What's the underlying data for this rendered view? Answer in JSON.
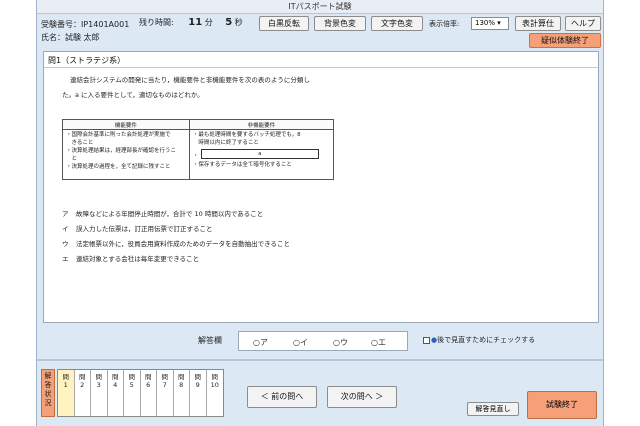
{
  "window": {
    "title": "ITパスポート試験"
  },
  "header": {
    "exam_number_label": "受験番号：IP1401A001",
    "name_label": "氏名：試験 太郎",
    "remaining_label": "残り時間:",
    "minutes": "11",
    "minutes_unit": "分",
    "seconds": "5",
    "seconds_unit": "秒"
  },
  "toolbar": {
    "invert_label": "白黒反転",
    "bg_color_label": "背景色変",
    "text_color_label": "文字色変",
    "zoom_label": "表示倍率:",
    "zoom_value": "130% ▾",
    "calc_label": "表計算仕",
    "help_label": "ヘルプ",
    "end_mock_label": "疑似体験終了"
  },
  "question": {
    "title": "問1（ストラテジ系）",
    "stem_line1": "連結会計システムの開発に当たり，機能要件と非機能要件を次の表のように分類し",
    "stem_line2": "た。a に入る要件として，適切なものはどれか。",
    "table": {
      "headers": [
        "機能要件",
        "非機能要件"
      ],
      "functional": [
        "・国際会計基準に則った会計処理が実施で",
        "　きること",
        "・決算処理結果は，経理部長が確認を行うこ",
        "　と",
        "・決算処理の過程を，全て記録に残すこと"
      ],
      "nonfunctional_top": [
        "・最も処理時間を要するバッチ処理でも，8",
        "　時間以内に終了すること"
      ],
      "blank_bullet": "・",
      "blank_label": "a",
      "nonfunctional_bottom": "・保存するデータは全て暗号化すること"
    },
    "choices": [
      {
        "key": "ア",
        "text": "故障などによる年間停止時間が，合計で 10 時間以内であること"
      },
      {
        "key": "イ",
        "text": "誤入力した伝票は，訂正用伝票で訂正すること"
      },
      {
        "key": "ウ",
        "text": "法定帳票以外に，役員会用資料作成のためのデータを自動抽出できること"
      },
      {
        "key": "エ",
        "text": "連結対象とする会社は毎年変更できること"
      }
    ]
  },
  "answer": {
    "label": "解答欄",
    "options": [
      "○ア",
      "○イ",
      "○ウ",
      "○エ"
    ],
    "review_check_label": "後で見直すためにチェックする"
  },
  "footer": {
    "status_label": "解答状況",
    "question_prefix": "問",
    "question_numbers": [
      "1",
      "2",
      "3",
      "4",
      "5",
      "6",
      "7",
      "8",
      "9",
      "10"
    ],
    "prev_label": "＜ 前の問へ",
    "next_label": "次の問へ ＞",
    "review_label": "解答見直し",
    "end_exam_label": "試験終了"
  }
}
